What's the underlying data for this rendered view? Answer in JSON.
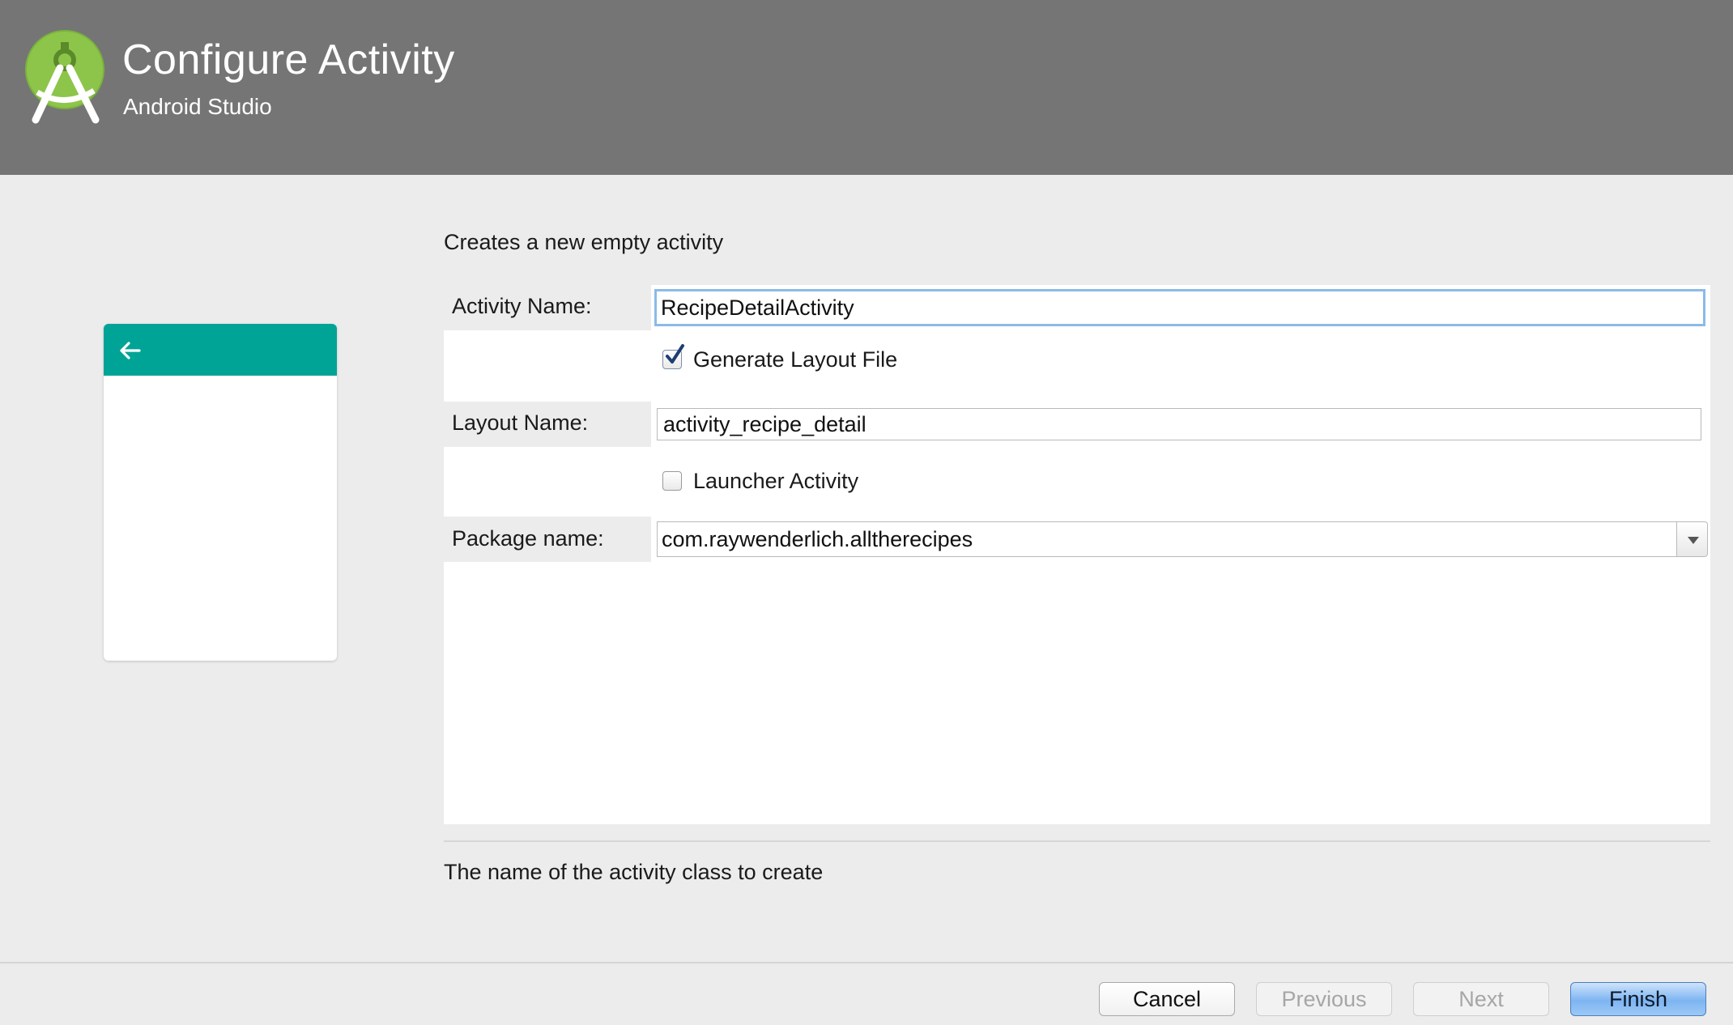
{
  "header": {
    "title": "Configure Activity",
    "subtitle": "Android Studio",
    "logo_icon": "android-studio-logo-icon"
  },
  "preview": {
    "toolbar_color": "#00a497",
    "back_icon": "arrow-left-icon"
  },
  "description": "Creates a new empty activity",
  "form": {
    "activity_name": {
      "label": "Activity Name:",
      "value": "RecipeDetailActivity"
    },
    "generate_layout": {
      "label": "Generate Layout File",
      "checked": true
    },
    "layout_name": {
      "label": "Layout Name:",
      "value": "activity_recipe_detail"
    },
    "launcher_activity": {
      "label": "Launcher Activity",
      "checked": false
    },
    "package_name": {
      "label": "Package name:",
      "value": "com.raywenderlich.alltherecipes"
    }
  },
  "hint": "The name of the activity class to create",
  "buttons": {
    "cancel": "Cancel",
    "previous": "Previous",
    "next": "Next",
    "finish": "Finish"
  },
  "colors": {
    "header_bg": "#757575",
    "accent_teal": "#00a497",
    "focus_border": "#8bbbe8",
    "primary_button": "#7db5f2"
  }
}
